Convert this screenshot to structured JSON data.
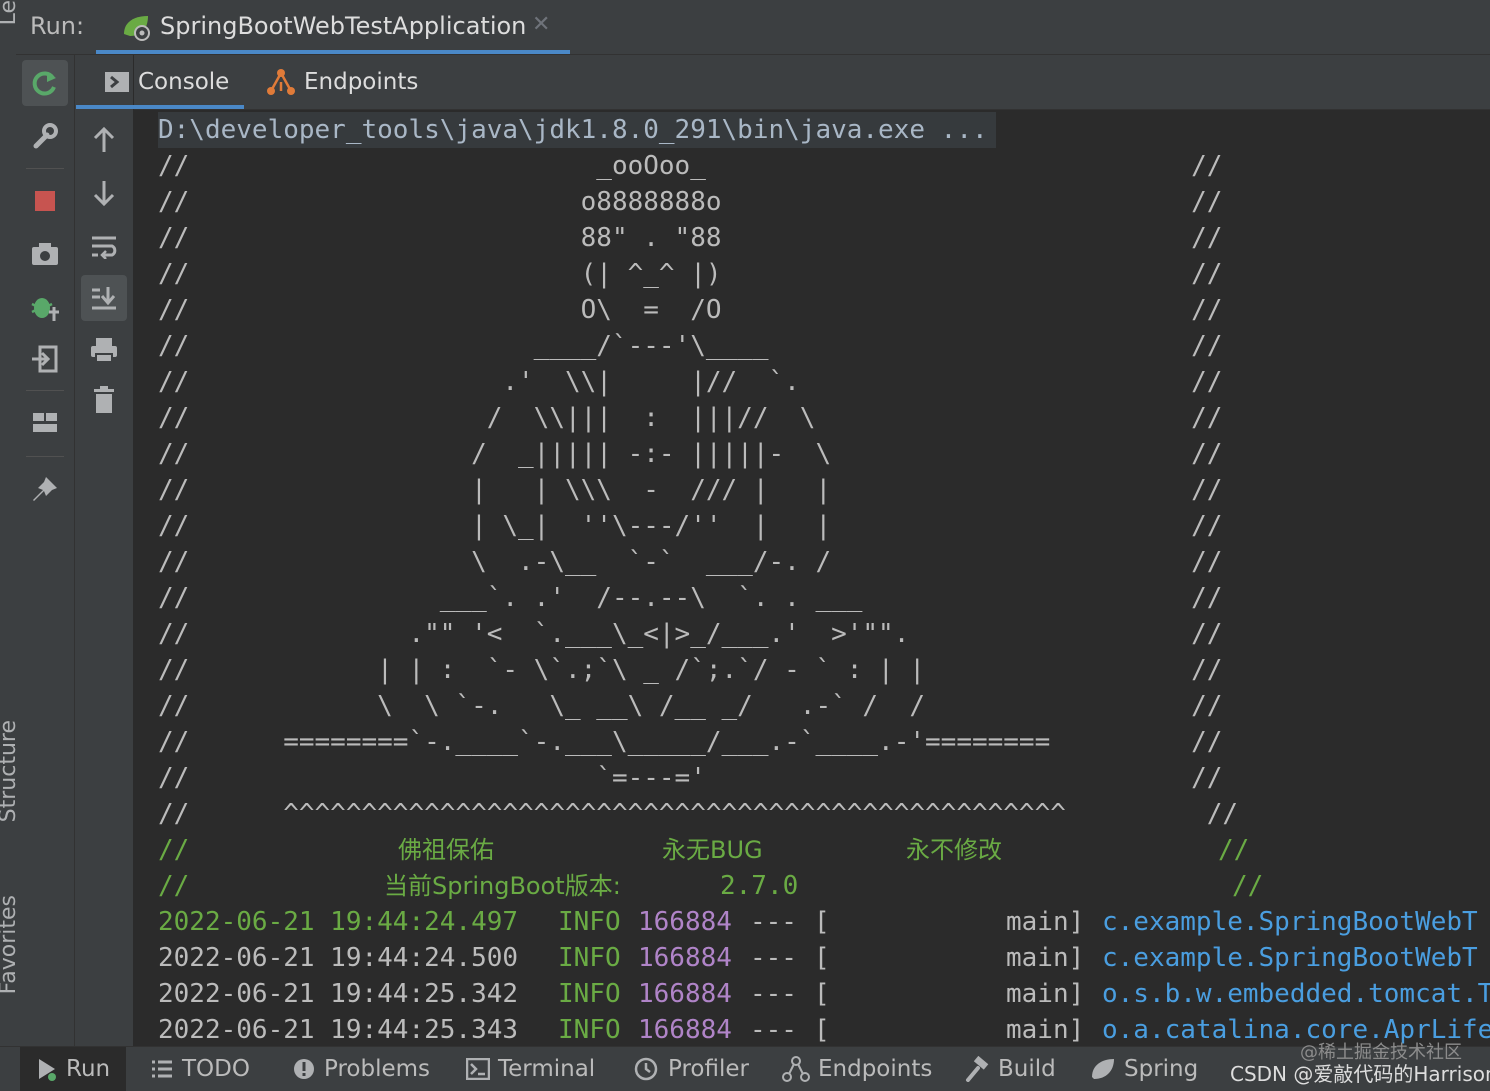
{
  "left_edge": {
    "label_top": "Le",
    "label_structure": "Structure",
    "label_favorites": "Favorites"
  },
  "run_bar": {
    "label": "Run:",
    "tab_title": "SpringBootWebTestApplication",
    "close_glyph": "✕"
  },
  "console_tabs": [
    {
      "label": "Console"
    },
    {
      "label": "Endpoints"
    }
  ],
  "console": {
    "command": "D:\\developer_tools\\java\\jdk1.8.0_291\\bin\\java.exe ...",
    "banner": [
      "//                          _ooOoo_                               //",
      "//                         o8888888o                              //",
      "//                         88\" . \"88                              //",
      "//                         (| ^_^ |)                              //",
      "//                         O\\  =  /O                              //",
      "//                      ____/`---'\\____                           //",
      "//                    .'  \\\\|     |//  `.                         //",
      "//                   /  \\\\|||  :  |||//  \\                        //",
      "//                  /  _||||| -:- |||||-  \\                       //",
      "//                  |   | \\\\\\  -  /// |   |                       //",
      "//                  | \\_|  ''\\---/''  |   |                       //",
      "//                  \\  .-\\__  `-`  ___/-. /                       //",
      "//                ___`. .'  /--.--\\  `. . ___                     //",
      "//              .\"\" '<  `.___\\_<|>_/___.'  >'\"\".                  //",
      "//            | | :  `- \\`.;`\\ _ /`;.`/ - ` : | |                 //",
      "//            \\  \\ `-.   \\_ __\\ /__ _/   .-` /  /                 //",
      "//      ========`-.____`-.___\\_____/___.-`____.-'========         //",
      "//                          `=---='                               //",
      "//      ^^^^^^^^^^^^^^^^^^^^^^^^^^^^^^^^^^^^^^^^^^^^^^^^^^         //"
    ],
    "blessing": {
      "prefix": "//",
      "item1": "佛祖保佑",
      "item2": "永无BUG",
      "item3": "永不修改",
      "suffix": "//"
    },
    "version_line": {
      "prefix": "//",
      "label": "当前SpringBoot版本:",
      "value": "2.7.0",
      "suffix": "//"
    },
    "logs": [
      {
        "timestamp": "2022-06-21 19:44:24.497",
        "level": "INFO",
        "pid": "166884",
        "sep": "---",
        "bracket": "[",
        "thread": "main]",
        "logger": "c.example.SpringBootWebT"
      },
      {
        "timestamp": "2022-06-21 19:44:24.500",
        "level": "INFO",
        "pid": "166884",
        "sep": "---",
        "bracket": "[",
        "thread": "main]",
        "logger": "c.example.SpringBootWebT"
      },
      {
        "timestamp": "2022-06-21 19:44:25.342",
        "level": "INFO",
        "pid": "166884",
        "sep": "---",
        "bracket": "[",
        "thread": "main]",
        "logger": "o.s.b.w.embedded.tomcat.T"
      },
      {
        "timestamp": "2022-06-21 19:44:25.343",
        "level": "INFO",
        "pid": "166884",
        "sep": "---",
        "bracket": "[",
        "thread": "main]",
        "logger": "o.a.catalina.core.AprLife"
      }
    ]
  },
  "bottom_bar": [
    {
      "label": "Run"
    },
    {
      "label": "TODO"
    },
    {
      "label": "Problems"
    },
    {
      "label": "Terminal"
    },
    {
      "label": "Profiler"
    },
    {
      "label": "Endpoints"
    },
    {
      "label": "Build"
    },
    {
      "label": "Spring"
    }
  ],
  "watermark": "@稀土掘金技术社区",
  "csdn_credit": "CSDN @爱敲代码的Harrison",
  "colors": {
    "green": "#6aab44",
    "purple": "#b084c8",
    "blue": "#4a9ee0",
    "accent": "#4a88c7",
    "stop_red": "#c75450"
  }
}
